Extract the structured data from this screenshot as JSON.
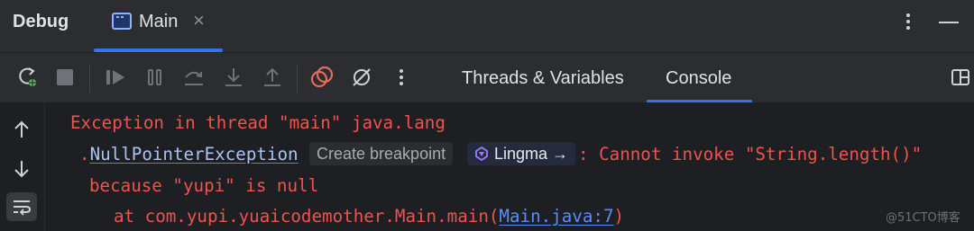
{
  "header": {
    "title": "Debug",
    "tab": {
      "label": "Main",
      "close": "×"
    }
  },
  "toolbar": {
    "tabs": [
      {
        "label": "Threads & Variables",
        "active": false
      },
      {
        "label": "Console",
        "active": true
      }
    ],
    "icons": [
      "rerun-debug-icon",
      "stop-icon",
      "resume-icon",
      "pause-icon",
      "step-over-icon",
      "step-into-icon",
      "step-out-icon",
      "view-breakpoints-icon",
      "mute-breakpoints-icon",
      "more-icon"
    ]
  },
  "console": {
    "line1": "Exception in thread \"main\" java.lang",
    "line2_prefix": ".",
    "exception_class": "NullPointerException",
    "hint_create_breakpoint": "Create breakpoint",
    "hint_lingma": "Lingma →",
    "line2_suffix": ": Cannot invoke \"String.length()\"",
    "line3": "because \"yupi\" is null",
    "line4_prefix": "at com.yupi.yuaicodemother.Main.main(",
    "line4_link": "Main.java:7",
    "line4_suffix": ")"
  },
  "watermark": "@51CTO博客",
  "colors": {
    "accent": "#3574f0",
    "error_text": "#f0524f",
    "link": "#5a8cff",
    "rerun_red": "#e06c5c"
  }
}
